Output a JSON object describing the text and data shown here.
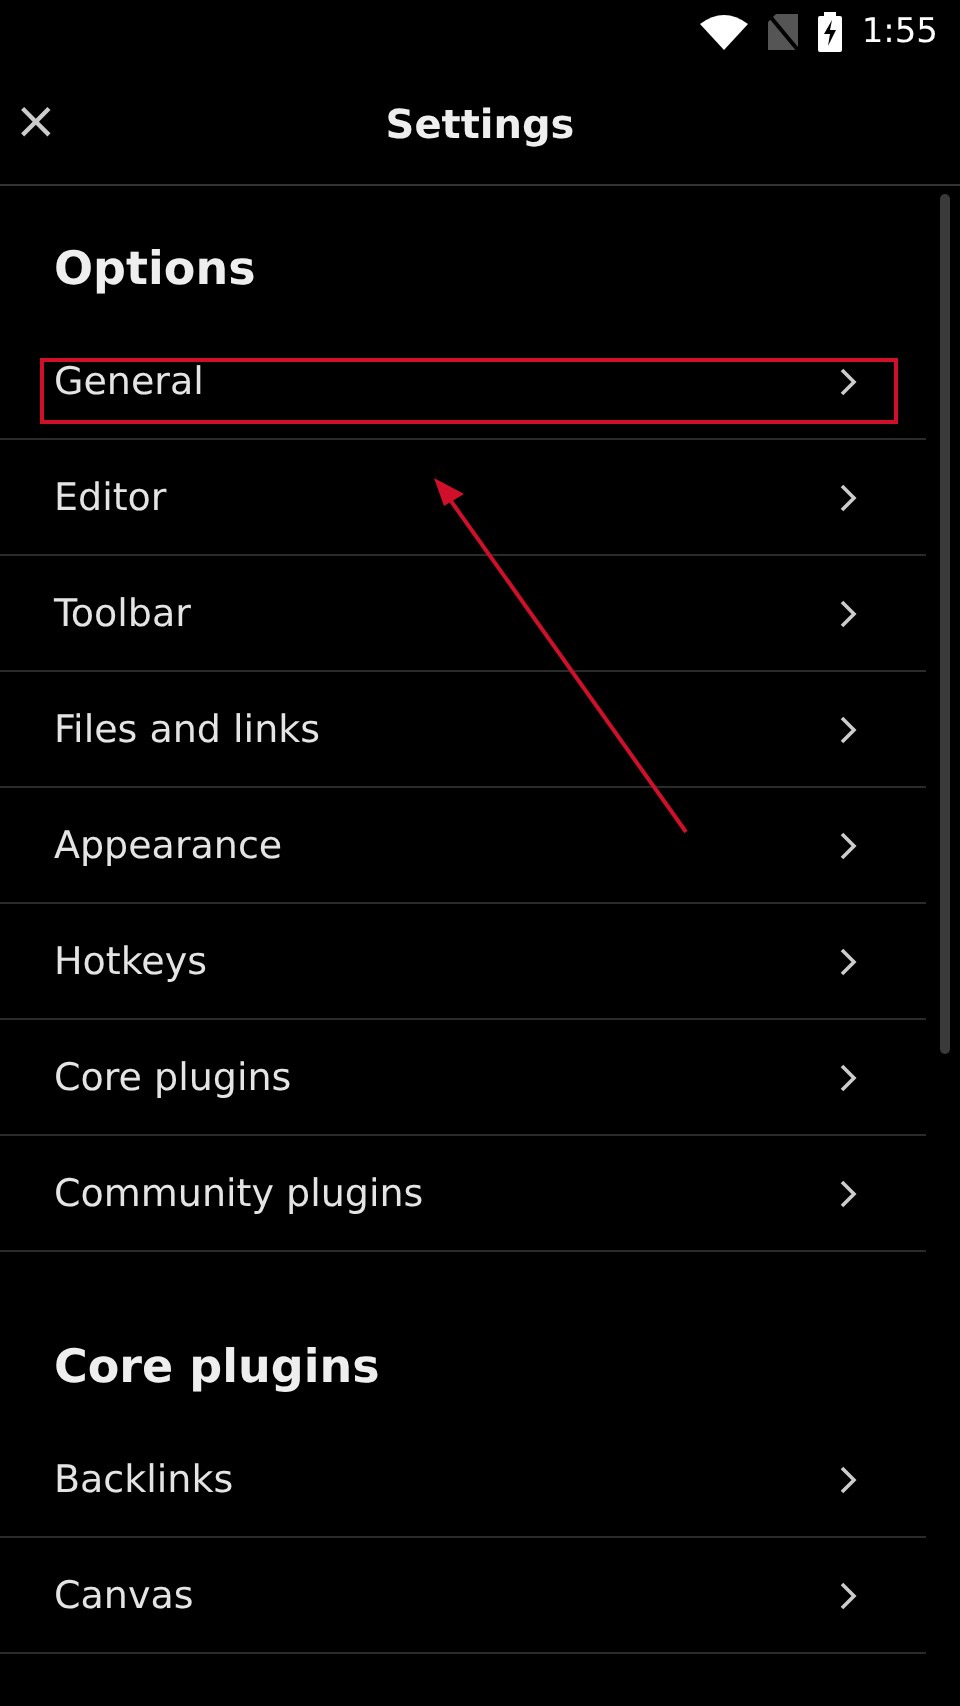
{
  "status_bar": {
    "time": "1:55"
  },
  "header": {
    "close": "×",
    "title": "Settings"
  },
  "sections": [
    {
      "title": "Options",
      "items": [
        {
          "label": "General",
          "highlighted": true
        },
        {
          "label": "Editor",
          "highlighted": false
        },
        {
          "label": "Toolbar",
          "highlighted": false
        },
        {
          "label": "Files and links",
          "highlighted": false
        },
        {
          "label": "Appearance",
          "highlighted": false
        },
        {
          "label": "Hotkeys",
          "highlighted": false
        },
        {
          "label": "Core plugins",
          "highlighted": false
        },
        {
          "label": "Community plugins",
          "highlighted": false
        }
      ]
    },
    {
      "title": "Core plugins",
      "items": [
        {
          "label": "Backlinks",
          "highlighted": false
        },
        {
          "label": "Canvas",
          "highlighted": false
        }
      ]
    }
  ]
}
